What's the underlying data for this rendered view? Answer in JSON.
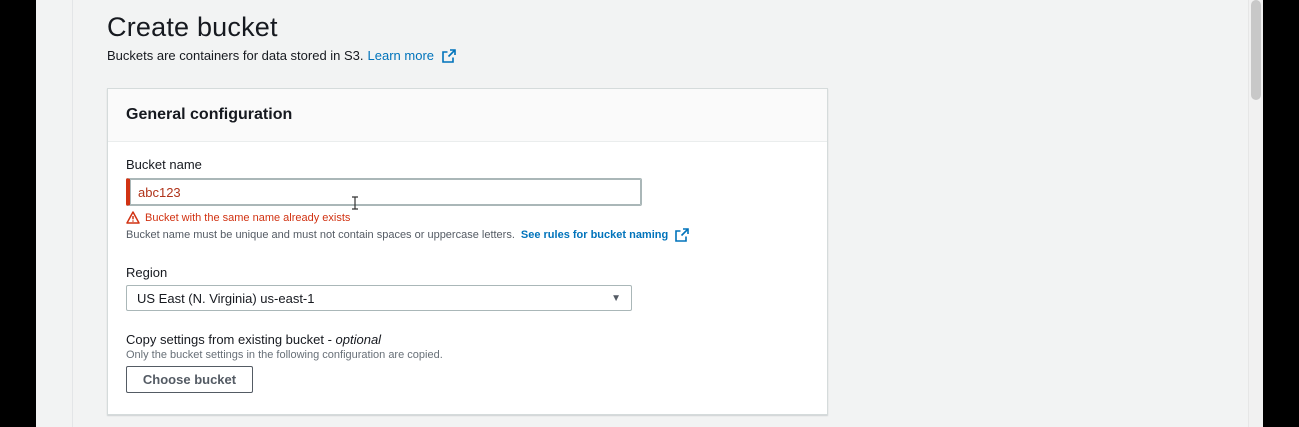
{
  "page": {
    "title": "Create bucket",
    "description": "Buckets are containers for data stored in S3.",
    "learn_more": "Learn more"
  },
  "general": {
    "title": "General configuration",
    "bucket_name": {
      "label": "Bucket name",
      "value": "abc123",
      "error": "Bucket with the same name already exists",
      "help": "Bucket name must be unique and must not contain spaces or uppercase letters.",
      "help_link": "See rules for bucket naming"
    },
    "region": {
      "label": "Region",
      "selected": "US East (N. Virginia) us-east-1"
    },
    "copy_settings": {
      "label": "Copy settings from existing bucket - ",
      "label_optional": "optional",
      "description": "Only the bucket settings in the following configuration are copied.",
      "button": "Choose bucket"
    }
  },
  "colors": {
    "link": "#0073bb",
    "error": "#d13212",
    "border": "#aab7b8",
    "background": "#f2f3f3"
  },
  "icons": {
    "external_link": "external-link-icon",
    "warning": "warning-icon",
    "dropdown": "caret-down-icon",
    "text_cursor": "text-cursor-icon"
  }
}
